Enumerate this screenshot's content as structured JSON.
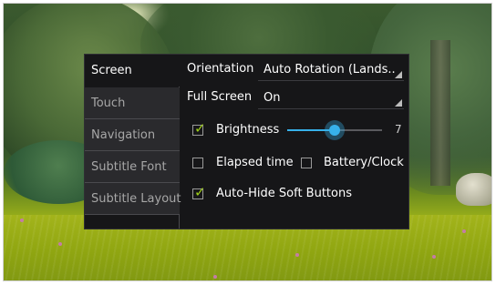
{
  "sidebar": {
    "items": [
      {
        "label": "Screen"
      },
      {
        "label": "Touch"
      },
      {
        "label": "Navigation"
      },
      {
        "label": "Subtitle Font"
      },
      {
        "label": "Subtitle Layout"
      }
    ]
  },
  "screen": {
    "orientation_label": "Orientation",
    "orientation_value": "Auto Rotation (Lands..",
    "fullscreen_label": "Full Screen",
    "fullscreen_value": "On",
    "brightness_label": "Brightness",
    "brightness_checked": true,
    "brightness_value": "7",
    "brightness_level": 0.5,
    "elapsed_label": "Elapsed time",
    "elapsed_checked": false,
    "battery_label": "Battery/Clock",
    "battery_checked": false,
    "autohide_label": "Auto-Hide Soft Buttons",
    "autohide_checked": true
  },
  "colors": {
    "accent": "#37b1ea",
    "check": "#9ccc18",
    "panel_bg": "#161618"
  }
}
